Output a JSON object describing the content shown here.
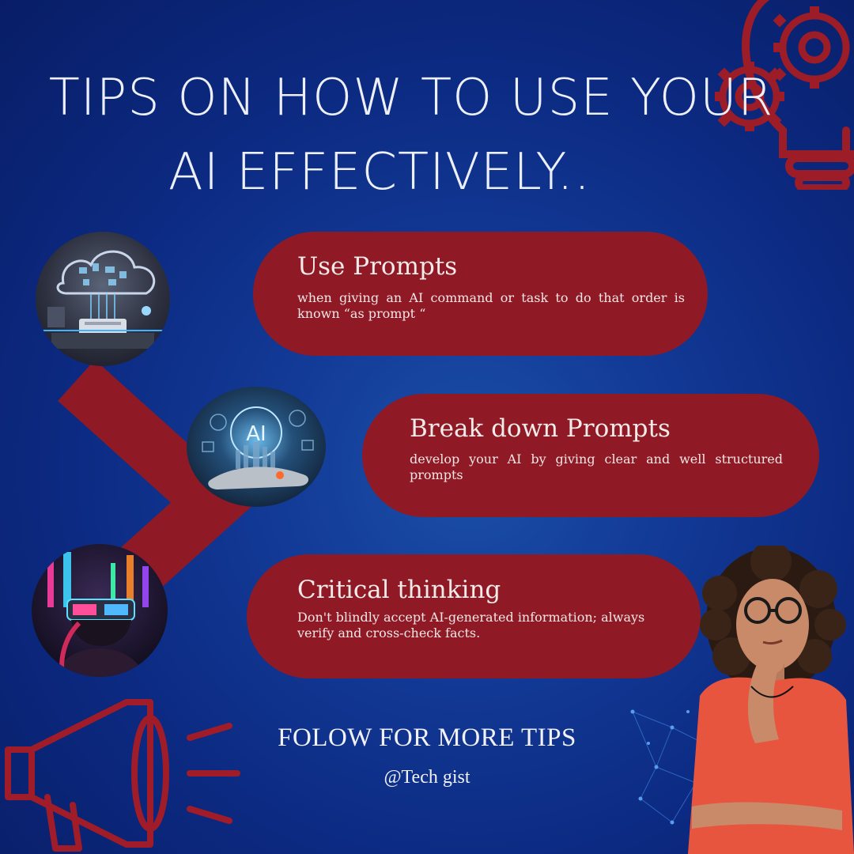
{
  "title": {
    "line1": "TIPS ON HOW TO USE YOUR",
    "line2": "AI EFFECTIVELY.."
  },
  "tips": [
    {
      "heading": "Use Prompts",
      "body": "when giving an AI command or task to do that order is known “as prompt “"
    },
    {
      "heading": "Break down Prompts",
      "body": "develop your AI by giving clear and well structured prompts"
    },
    {
      "heading": "Critical thinking",
      "body": " Don't blindly accept AI-generated information; always verify and cross-check facts."
    }
  ],
  "circle_center_label": "AI",
  "footer": {
    "follow": "FOLOW FOR MORE TIPS",
    "handle": "@Tech gist"
  },
  "colors": {
    "background": "#0c2a82",
    "pill": "#8f1a25",
    "accent_red": "#a01c28",
    "text": "#f3eaea"
  },
  "icons": [
    "lightbulb-gear-icon",
    "megaphone-icon",
    "network-dots-icon"
  ]
}
